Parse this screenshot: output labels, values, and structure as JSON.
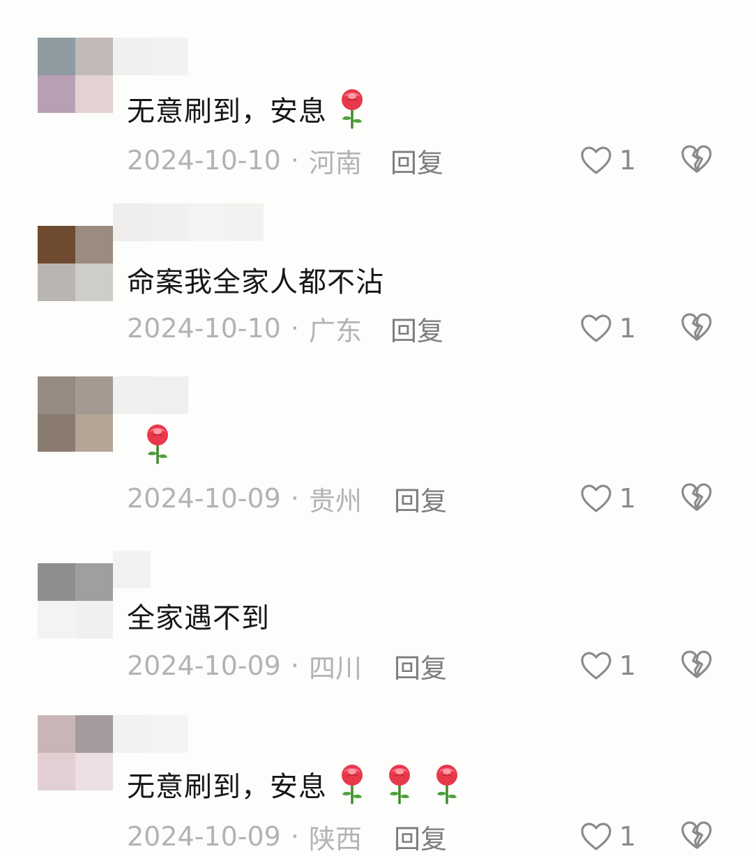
{
  "comments": [
    {
      "text": "无意刷到，安息",
      "roses": 1,
      "date": "2024-10-10",
      "location": "河南",
      "reply_label": "回复",
      "likes": "1"
    },
    {
      "text": "命案我全家人都不沾",
      "roses": 0,
      "date": "2024-10-10",
      "location": "广东",
      "reply_label": "回复",
      "likes": "1"
    },
    {
      "text": "",
      "roses": 1,
      "date": "2024-10-09",
      "location": "贵州",
      "reply_label": "回复",
      "likes": "1"
    },
    {
      "text": "全家遇不到",
      "roses": 0,
      "date": "2024-10-09",
      "location": "四川",
      "reply_label": "回复",
      "likes": "1"
    },
    {
      "text": "无意刷到，安息",
      "roses": 3,
      "date": "2024-10-09",
      "location": "陕西",
      "reply_label": "回复",
      "likes": "1"
    }
  ],
  "separator": "·",
  "icons": {
    "like": "heart-outline-icon",
    "dislike": "broken-heart-icon",
    "emoji": "rose-emoji"
  },
  "colors": {
    "background": "#fdfdfb",
    "text": "#161616",
    "meta": "#b3b3b3",
    "reply": "#7d7d7d",
    "icon": "#8a8a8a"
  }
}
